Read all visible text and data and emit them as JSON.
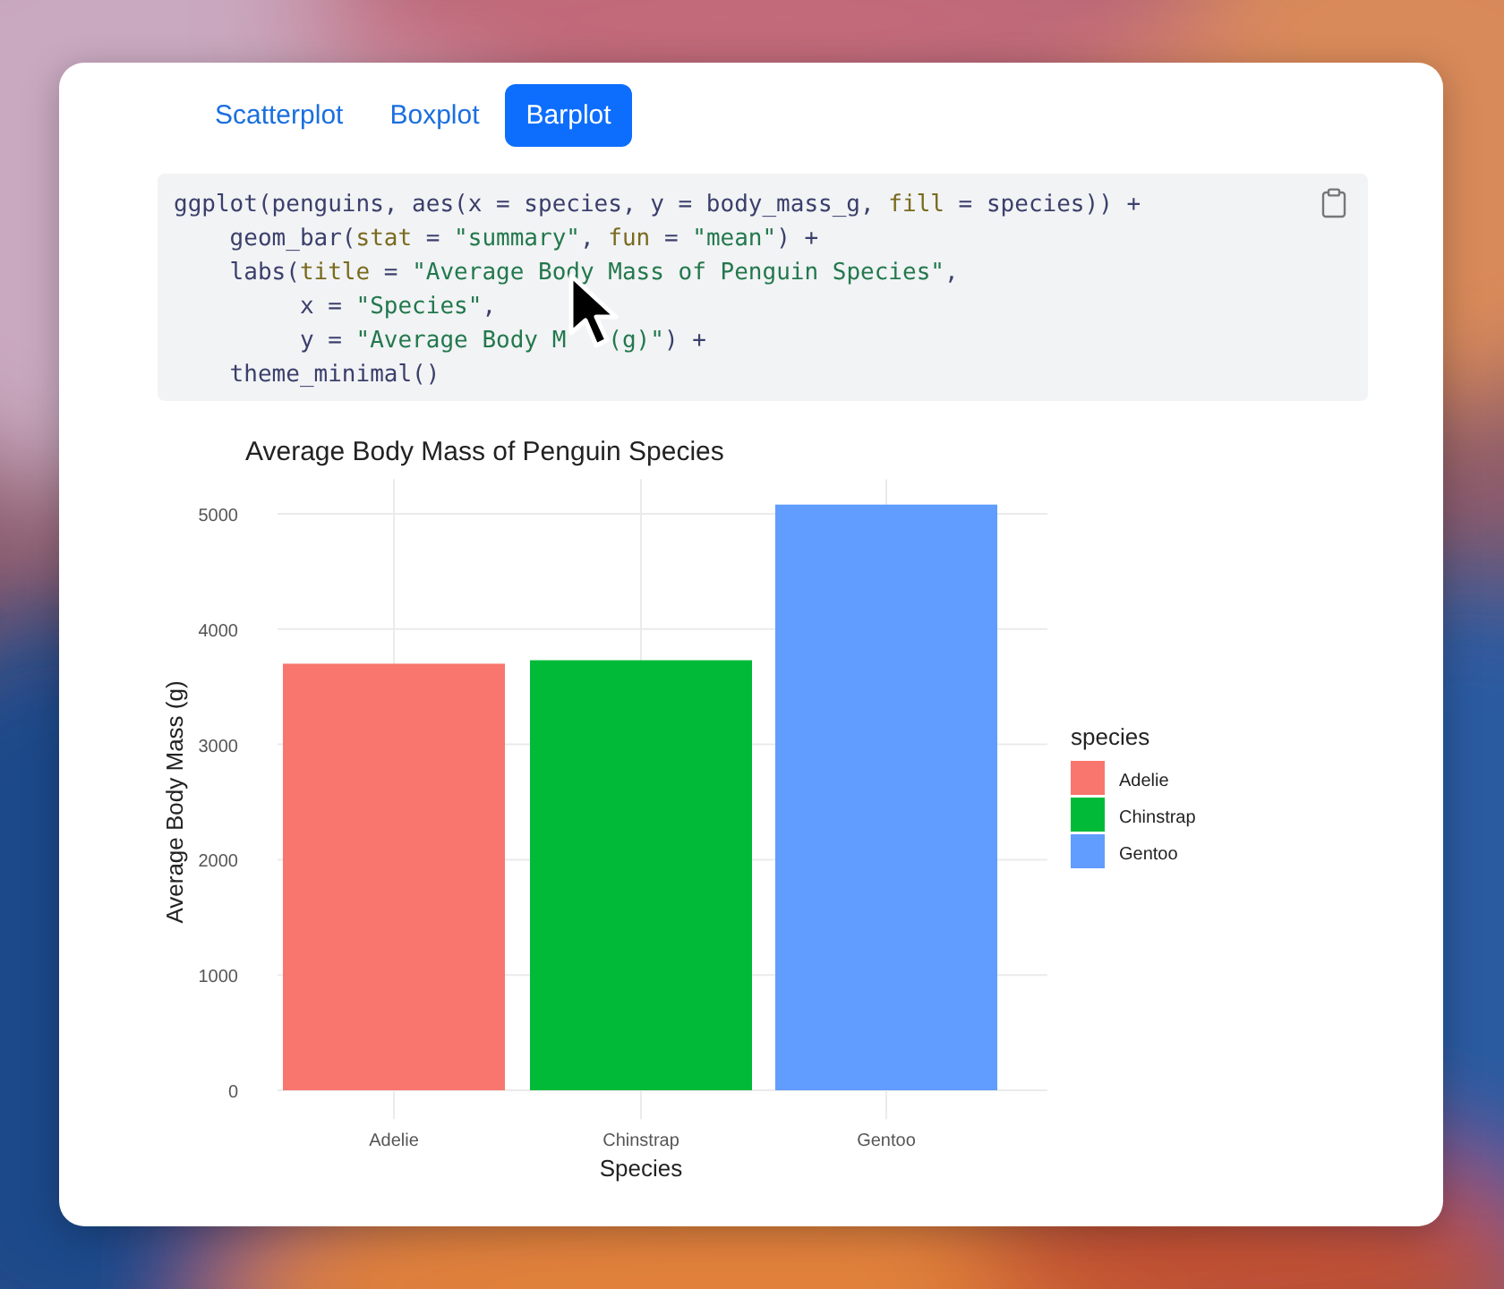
{
  "tabs": [
    {
      "label": "Scatterplot",
      "selected": false
    },
    {
      "label": "Boxplot",
      "selected": false
    },
    {
      "label": "Barplot",
      "selected": true
    }
  ],
  "code": {
    "lines": [
      [
        {
          "kind": "plain",
          "text": "ggplot(penguins, aes(x = species, y = body_mass_g, "
        },
        {
          "kind": "arg",
          "text": "fill"
        },
        {
          "kind": "plain",
          "text": " = species)) +"
        }
      ],
      [
        {
          "kind": "plain",
          "text": "    geom_bar("
        },
        {
          "kind": "arg",
          "text": "stat"
        },
        {
          "kind": "plain",
          "text": " = "
        },
        {
          "kind": "str",
          "text": "\"summary\""
        },
        {
          "kind": "plain",
          "text": ", "
        },
        {
          "kind": "arg",
          "text": "fun"
        },
        {
          "kind": "plain",
          "text": " = "
        },
        {
          "kind": "str",
          "text": "\"mean\""
        },
        {
          "kind": "plain",
          "text": ") +"
        }
      ],
      [
        {
          "kind": "plain",
          "text": "    labs("
        },
        {
          "kind": "arg",
          "text": "title"
        },
        {
          "kind": "plain",
          "text": " = "
        },
        {
          "kind": "str",
          "text": "\"Average Body Mass of Penguin Species\""
        },
        {
          "kind": "plain",
          "text": ","
        }
      ],
      [
        {
          "kind": "plain",
          "text": "         x = "
        },
        {
          "kind": "str",
          "text": "\"Species\""
        },
        {
          "kind": "plain",
          "text": ","
        }
      ],
      [
        {
          "kind": "plain",
          "text": "         y = "
        },
        {
          "kind": "str",
          "text": "\"Average Body M"
        },
        {
          "kind": "gap"
        },
        {
          "kind": "str",
          "text": "(g)\""
        },
        {
          "kind": "plain",
          "text": ") +"
        }
      ],
      [
        {
          "kind": "plain",
          "text": "    theme_minimal()"
        }
      ]
    ]
  },
  "chart": {
    "chart_data": {
      "type": "bar",
      "title": "Average Body Mass of Penguin Species",
      "xlabel": "Species",
      "ylabel": "Average Body Mass (g)",
      "categories": [
        "Adelie",
        "Chinstrap",
        "Gentoo"
      ],
      "values": [
        3700,
        3730,
        5080
      ],
      "ylim": [
        -250,
        5300
      ],
      "yticks": [
        0,
        1000,
        2000,
        3000,
        4000,
        5000
      ],
      "grid": true
    },
    "legend": {
      "title": "species",
      "items": [
        {
          "label": "Adelie",
          "color": "#f8766d"
        },
        {
          "label": "Chinstrap",
          "color": "#00ba38"
        },
        {
          "label": "Gentoo",
          "color": "#619cff"
        }
      ]
    }
  }
}
